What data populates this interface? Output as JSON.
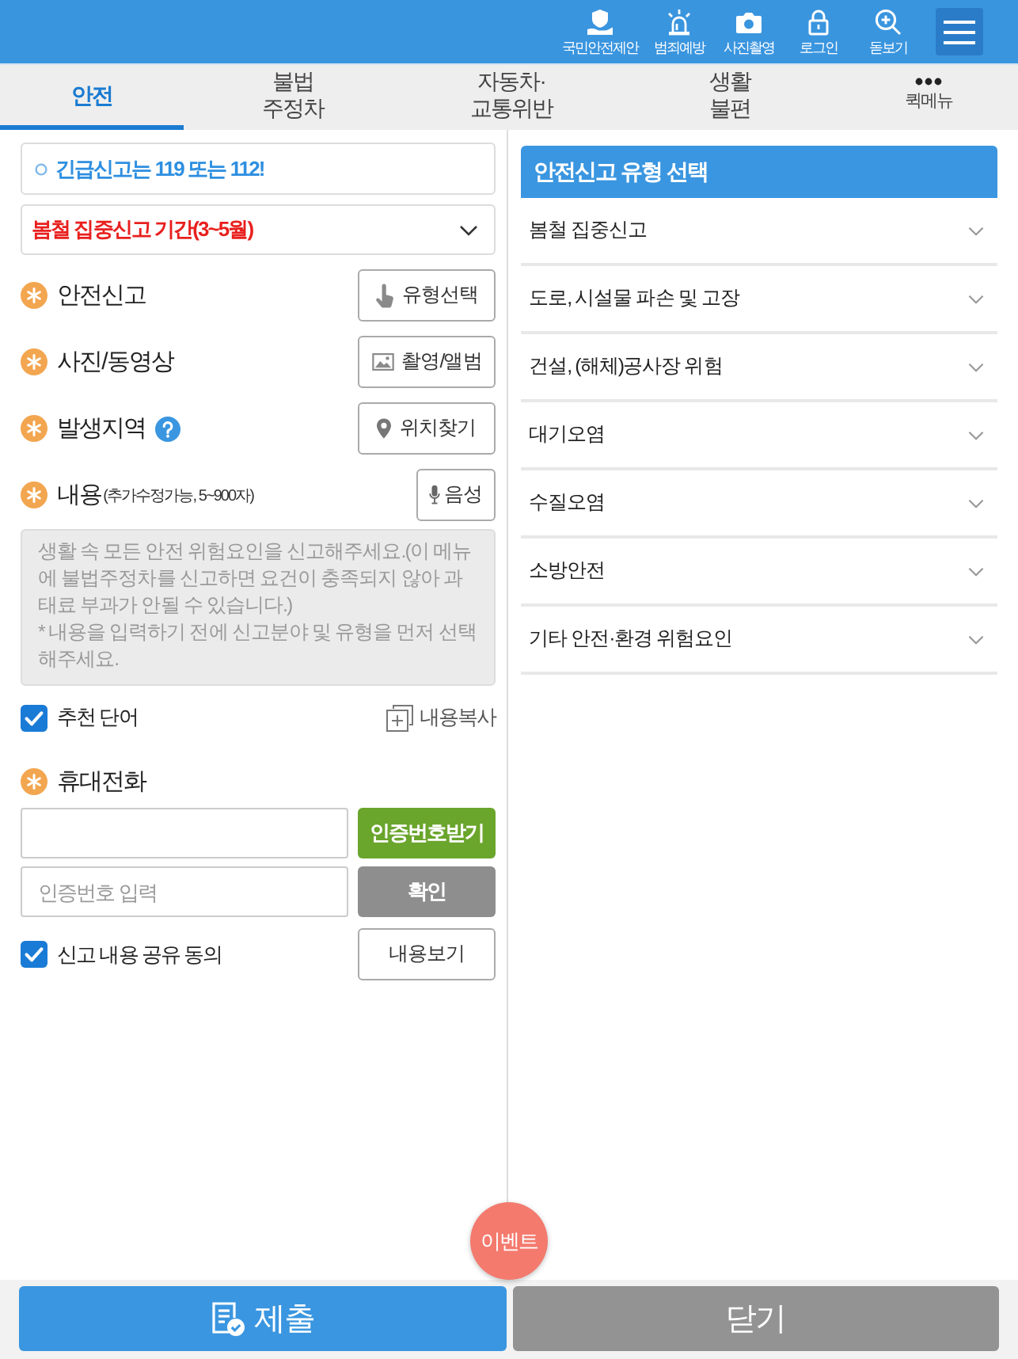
{
  "top_bar": {
    "actions": [
      {
        "label": "국민안전제안"
      },
      {
        "label": "범죄예방"
      },
      {
        "label": "사진촬영"
      },
      {
        "label": "로그인"
      },
      {
        "label": "돋보기"
      }
    ]
  },
  "tabs": [
    {
      "label": "안전",
      "selected": true,
      "kind": "text"
    },
    {
      "label": "불법\n주정차",
      "selected": false,
      "kind": "text"
    },
    {
      "label": "자동차·\n교통위반",
      "selected": false,
      "kind": "text"
    },
    {
      "label": "생활\n불편",
      "selected": false,
      "kind": "text"
    },
    {
      "label": "퀵메뉴",
      "selected": false,
      "kind": "more"
    }
  ],
  "notice": {
    "text": "긴급신고는 119 또는 112!"
  },
  "period_select": {
    "value": "봄철 집중신고 기간(3~5월)"
  },
  "fields": [
    {
      "kind": "type",
      "label": "안전신고",
      "required": true,
      "help": false,
      "button": "유형선택"
    },
    {
      "kind": "media",
      "label": "사진/동영상",
      "required": true,
      "help": false,
      "button": "촬영/앨범"
    },
    {
      "kind": "location",
      "label": "발생지역",
      "required": true,
      "help": true,
      "button": "위치찾기"
    },
    {
      "kind": "content",
      "label": "내용",
      "note": "(추가수정가능, 5~900자)",
      "required": true,
      "help": false,
      "button": "음성"
    }
  ],
  "content": {
    "placeholder": "생활 속 모든 안전 위험요인을 신고해주세요.(이 메뉴에 불법주정차를 신고하면 요건이 충족되지 않아 과태료 부과가 안될 수 있습니다.)\n* 내용을 입력하기 전에 신고분야 및 유형을 먼저 선택해주세요."
  },
  "recommend_words": {
    "label": "추천 단어",
    "checked": true
  },
  "copy_button": {
    "label": "내용복사"
  },
  "phone": {
    "label": "휴대전화",
    "required": true,
    "request_button": "인증번호받기",
    "code_placeholder": "인증번호 입력",
    "confirm_button": "확인"
  },
  "share_consent": {
    "label": "신고 내용 공유 동의",
    "checked": true,
    "view_button": "내용보기"
  },
  "type_panel": {
    "title": "안전신고 유형 선택",
    "items": [
      {
        "label": "봄철 집중신고",
        "expanded": false
      },
      {
        "label": "도로, 시설물 파손 및 고장",
        "expanded": false
      },
      {
        "label": "건설, (해체)공사장 위험",
        "expanded": false
      },
      {
        "label": "대기오염",
        "expanded": false
      },
      {
        "label": "수질오염",
        "expanded": false
      },
      {
        "label": "소방안전",
        "expanded": false
      },
      {
        "label": "기타 안전·환경 위험요인",
        "expanded": false
      }
    ]
  },
  "event_button": {
    "label": "이벤트"
  },
  "footer": {
    "submit": "제출",
    "close": "닫기"
  }
}
